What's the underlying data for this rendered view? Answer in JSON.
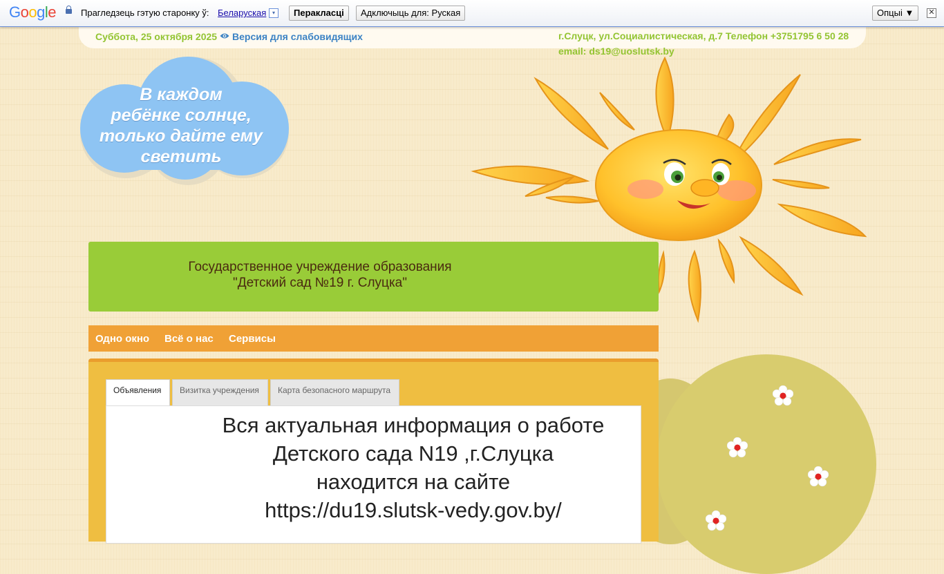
{
  "translate_bar": {
    "logo_letters": [
      "G",
      "o",
      "o",
      "g",
      "l",
      "e"
    ],
    "prompt": "Прагледзець гэтую старонку ў:",
    "language": "Беларуская",
    "language_arrow": "▾",
    "translate_button": "Перакласці",
    "turn_off_button": "Адключыць для: Руская",
    "options_button": "Опцыі ▼",
    "close_button": "✕"
  },
  "header": {
    "date": "Суббота, 25 октября 2025",
    "vision_link": "Версия для слабовидящих",
    "address": "г.Слуцк, ул.Социалистическая, д.7 Телефон +3751795 6 50 28",
    "email": "email: ds19@uoslutsk.by"
  },
  "slogan": [
    "В каждом",
    "ребёнке солнце,",
    "только дайте ему",
    "светить"
  ],
  "banner": {
    "line1": "Государственное учреждение образования",
    "line2": "\"Детский сад №19 г. Слуцка\""
  },
  "menu": [
    "Одно окно",
    "Всё о нас",
    "Сервисы"
  ],
  "tabs": [
    "Объявления",
    "Визитка учреждения",
    "Карта безопасного маршрута"
  ],
  "notice": [
    "Вся актуальная информация о работе",
    "Детского сада N19 ,г.Слуцка",
    "находится на сайте",
    "https://du19.slutsk-vedy.gov.by/"
  ],
  "colors": {
    "green": "#99cc38",
    "orange": "#f0a136",
    "link_blue": "#3b82c4",
    "cloud_blue": "#8ec4f3"
  }
}
